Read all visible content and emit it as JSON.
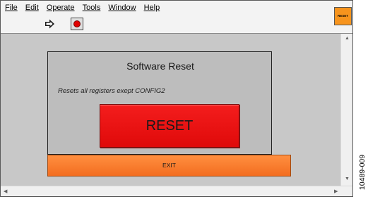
{
  "menu": {
    "items": [
      {
        "label": "File"
      },
      {
        "label": "Edit"
      },
      {
        "label": "Operate"
      },
      {
        "label": "Tools"
      },
      {
        "label": "Window"
      },
      {
        "label": "Help"
      }
    ]
  },
  "toolbar": {
    "run_icon": "run-arrow-icon",
    "stop_icon": "abort-stop-icon"
  },
  "window_icon": {
    "label": "RESET"
  },
  "panel": {
    "title": "Software Reset",
    "description": "Resets all registers exept CONFIG2",
    "reset_label": "RESET"
  },
  "exit_label": "EXIT",
  "figure_id": "10489-009",
  "colors": {
    "reset_button": "#EE1111",
    "exit_button": "#F77A30",
    "icon_badge": "#F7941D",
    "content_bg": "#C8C8C8"
  }
}
